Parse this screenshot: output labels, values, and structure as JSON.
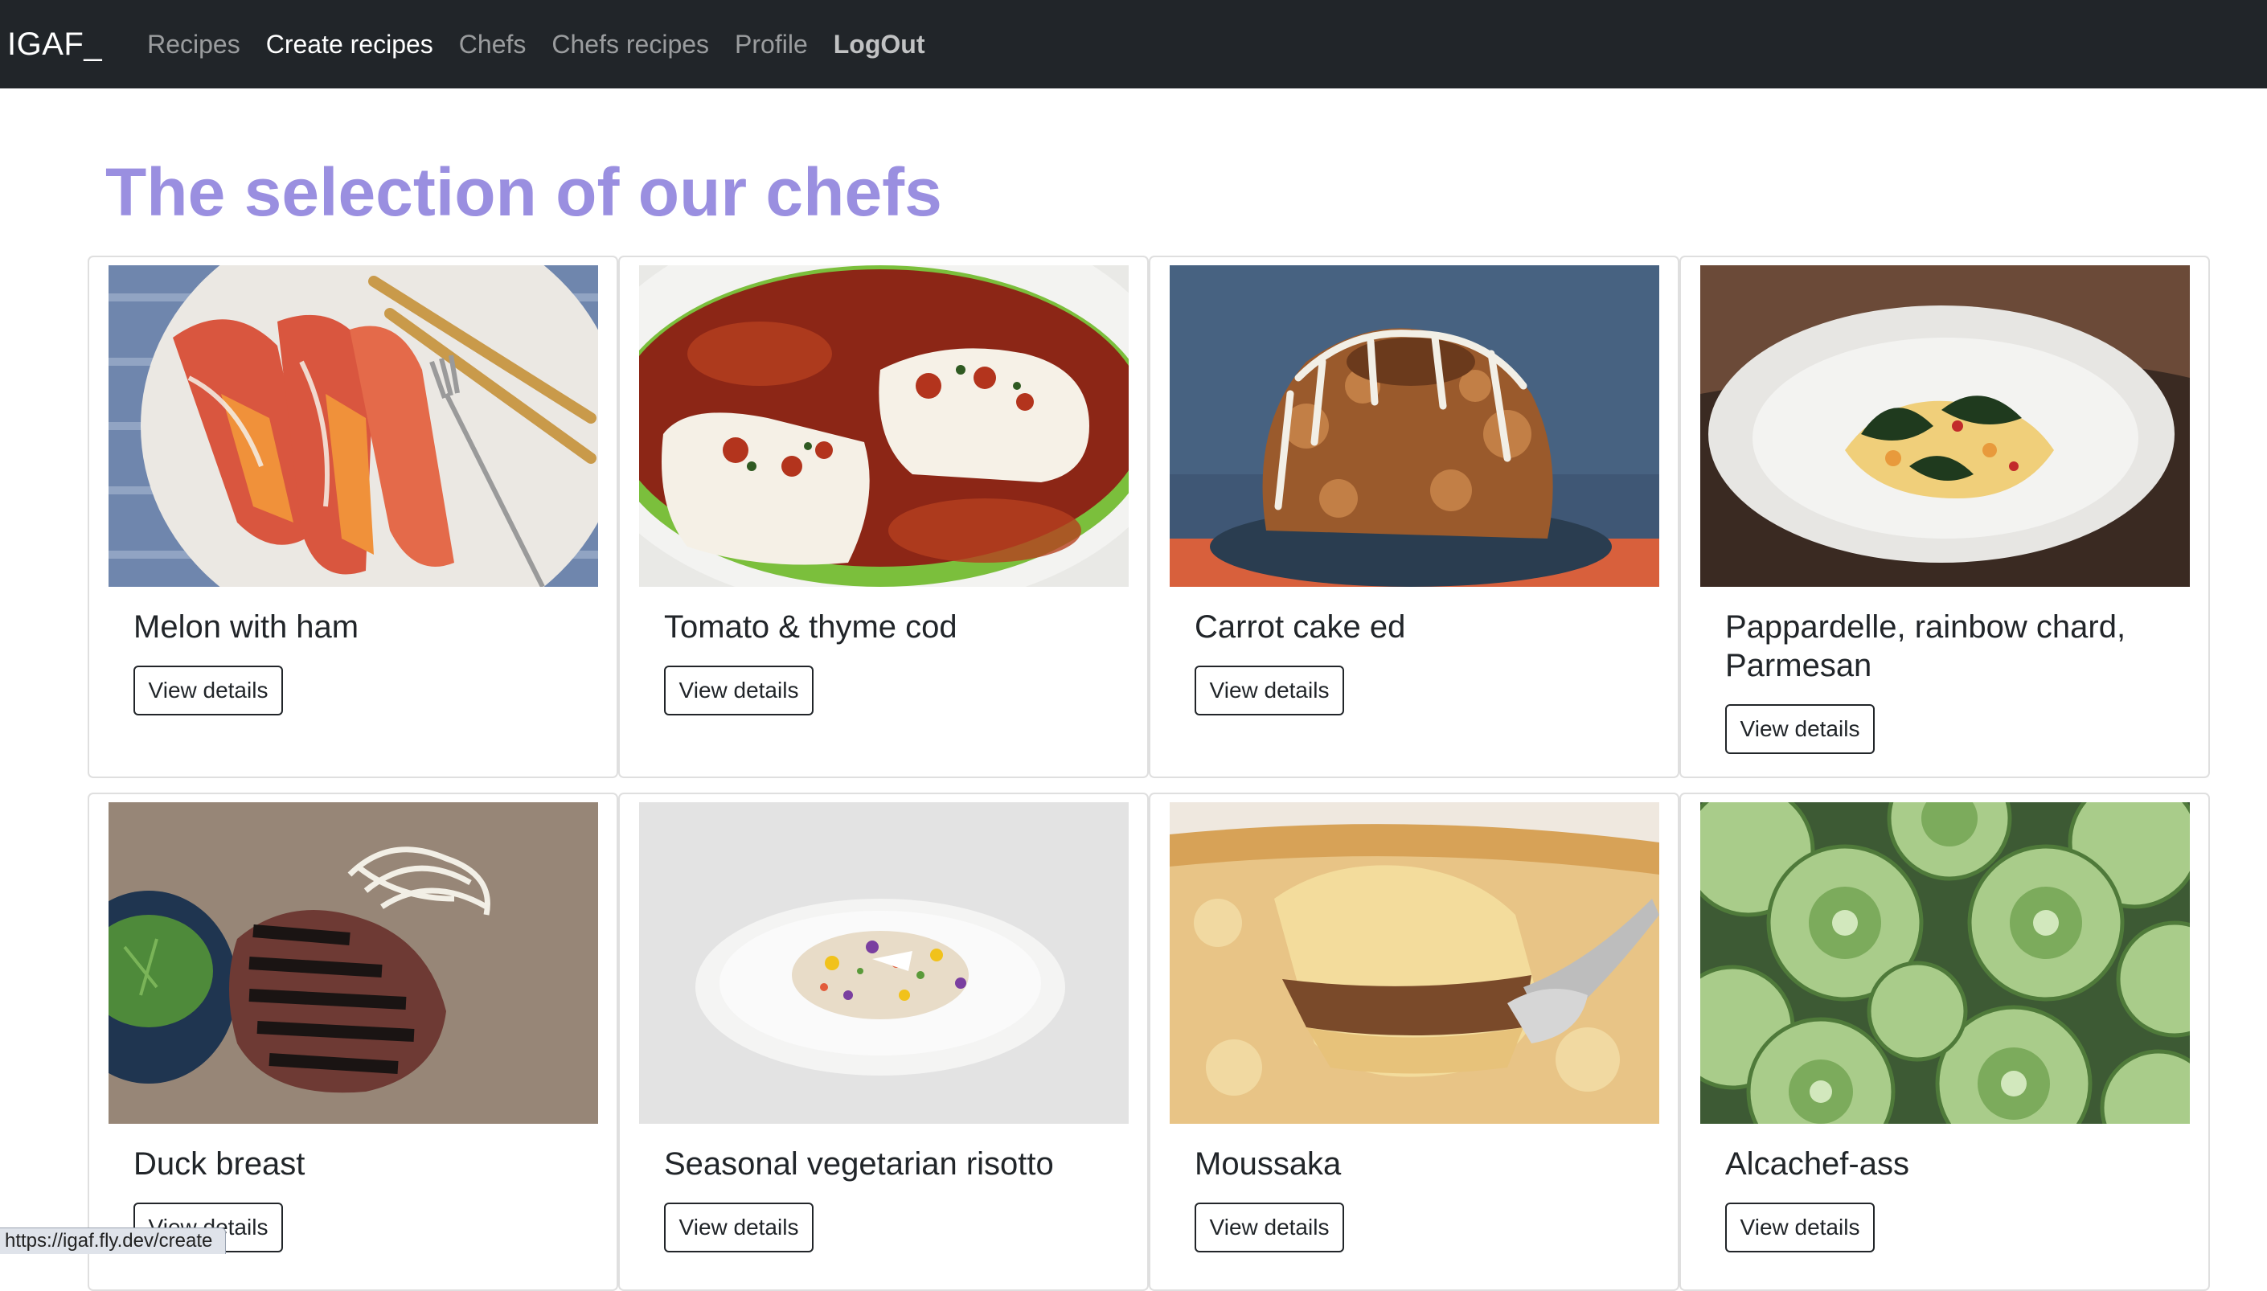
{
  "navbar": {
    "brand": "IGAF_",
    "links": [
      {
        "label": "Recipes"
      },
      {
        "label": "Create recipes"
      },
      {
        "label": "Chefs"
      },
      {
        "label": "Chefs recipes"
      },
      {
        "label": "Profile"
      },
      {
        "label": "LogOut"
      }
    ]
  },
  "page": {
    "heading": "The selection of our chefs"
  },
  "cards": [
    {
      "title": "Melon with ham",
      "button": "View details"
    },
    {
      "title": "Tomato & thyme cod",
      "button": "View details"
    },
    {
      "title": "Carrot cake ed",
      "button": "View details"
    },
    {
      "title": "Pappardelle, rainbow chard, Parmesan",
      "button": "View details"
    },
    {
      "title": "Duck breast",
      "button": "View details"
    },
    {
      "title": "Seasonal vegetarian risotto",
      "button": "View details"
    },
    {
      "title": "Moussaka",
      "button": "View details"
    },
    {
      "title": "Alcachef-ass",
      "button": "View details"
    }
  ],
  "status_bar": {
    "url": "https://igaf.fly.dev/create"
  }
}
